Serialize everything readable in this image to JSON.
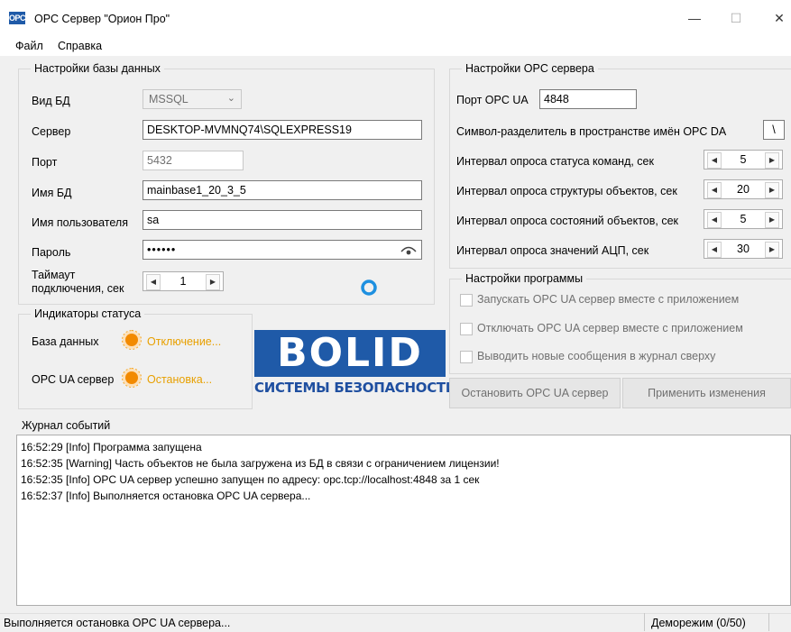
{
  "window": {
    "title": "OPC Сервер \"Орион Про\"",
    "icon_text": "OPC",
    "minimize": "—",
    "maximize": "☐",
    "close": "✕"
  },
  "menu": [
    "Файл",
    "Справка"
  ],
  "db": {
    "group_title": "Настройки базы данных",
    "db_type_label": "Вид БД",
    "db_type_value": "MSSQL",
    "server_label": "Сервер",
    "server_value": "DESKTOP-MVMNQ74\\SQLEXPRESS19",
    "port_label": "Порт",
    "port_value": "5432",
    "db_name_label": "Имя БД",
    "db_name_value": "mainbase1_20_3_5",
    "user_label": "Имя пользователя",
    "user_value": "sa",
    "password_label": "Пароль",
    "password_value": "••••••",
    "timeout_label_1": "Таймаут",
    "timeout_label_2": "подключения, сек",
    "timeout_value": "1"
  },
  "status": {
    "group_title": "Индикаторы статуса",
    "db_label": "База данных",
    "db_state": "Отключение...",
    "opc_label": "OPC UA сервер",
    "opc_state": "Остановка..."
  },
  "logo": {
    "word": "BOLID",
    "sub": "СИСТЕМЫ БЕЗОПАСНОСТИ"
  },
  "opc": {
    "group_title": "Настройки OPC сервера",
    "port_label": "Порт OPC UA",
    "port_value": "4848",
    "separator_label": "Символ-разделитель в пространстве имён OPC DA",
    "separator_value": "\\",
    "intervals": [
      {
        "label": "Интервал опроса статуса команд, сек",
        "value": "5"
      },
      {
        "label": "Интервал опроса структуры объектов, сек",
        "value": "20"
      },
      {
        "label": "Интервал опроса состояний объектов, сек",
        "value": "5"
      },
      {
        "label": "Интервал опроса значений АЦП, сек",
        "value": "30"
      }
    ]
  },
  "program": {
    "group_title": "Настройки программы",
    "options": [
      "Запускать OPC UA сервер вместе с приложением",
      "Отключать OPC UA сервер вместе с приложением",
      "Выводить новые сообщения в журнал сверху"
    ],
    "stop_button": "Остановить OPC UA сервер",
    "apply_button": "Применить изменения"
  },
  "log": {
    "title": "Журнал событий",
    "lines": [
      "16:52:29 [Info] Программа запущена",
      "16:52:35 [Warning] Часть объектов не была загружена из БД в связи с ограничением лицензии!",
      "16:52:35 [Info] OPC UA сервер успешно запущен по адресу: opc.tcp://localhost:4848 за 1 сек",
      "16:52:37 [Info] Выполняется остановка OPC UA сервера..."
    ]
  },
  "statusbar": {
    "message": "Выполняется остановка OPC UA сервера...",
    "mode": "Деморежим (0/50)"
  }
}
